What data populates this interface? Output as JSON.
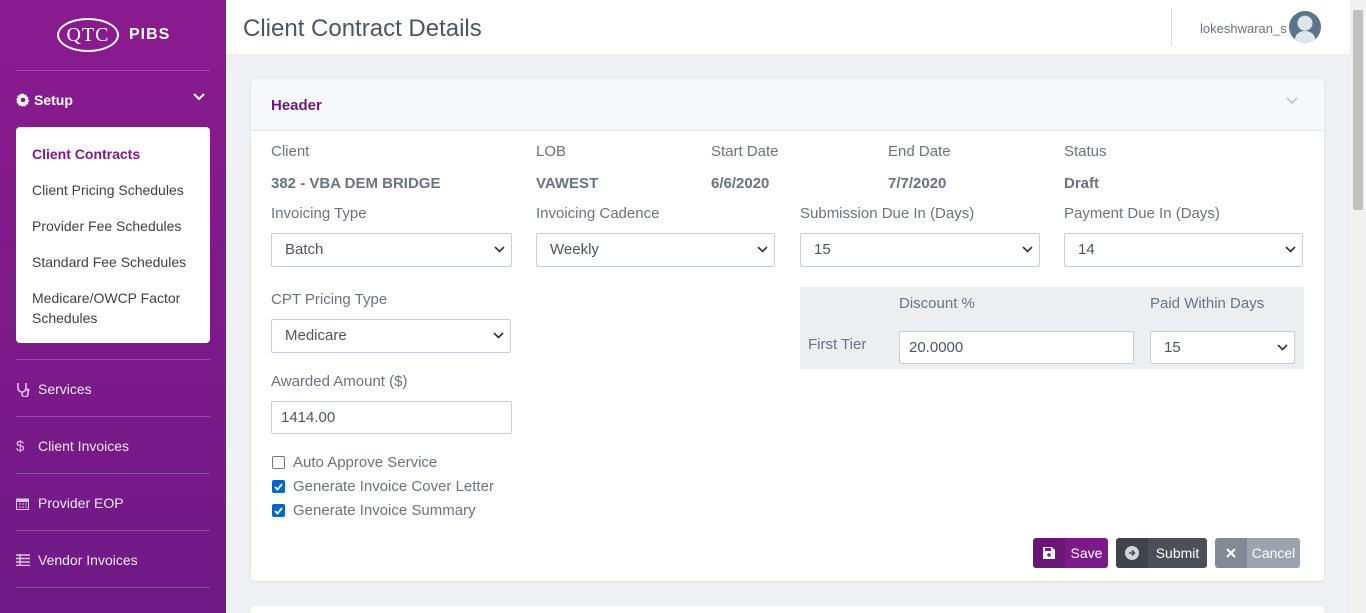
{
  "brand": {
    "logo": "QTC",
    "app": "PIBS"
  },
  "sidebar": {
    "setup_label": "Setup",
    "submenu": [
      {
        "label": "Client Contracts",
        "active": true
      },
      {
        "label": "Client Pricing Schedules"
      },
      {
        "label": "Provider Fee Schedules"
      },
      {
        "label": "Standard Fee Schedules"
      },
      {
        "label": "Medicare/OWCP Factor Schedules"
      }
    ],
    "nav": [
      {
        "label": "Services",
        "icon": "stethoscope-icon"
      },
      {
        "label": "Client Invoices",
        "icon": "dollar-icon"
      },
      {
        "label": "Provider EOP",
        "icon": "calendar-icon"
      },
      {
        "label": "Vendor Invoices",
        "icon": "table-icon"
      }
    ]
  },
  "header": {
    "title": "Client Contract Details",
    "username": "lokeshwaran_s"
  },
  "card": {
    "title": "Header",
    "client": {
      "label": "Client",
      "value": "382 - VBA DEM BRIDGE"
    },
    "lob": {
      "label": "LOB",
      "value": "VAWEST"
    },
    "start_date": {
      "label": "Start Date",
      "value": "6/6/2020"
    },
    "end_date": {
      "label": "End Date",
      "value": "7/7/2020"
    },
    "status": {
      "label": "Status",
      "value": "Draft"
    },
    "invoicing_type": {
      "label": "Invoicing Type",
      "value": "Batch"
    },
    "invoicing_cadence": {
      "label": "Invoicing Cadence",
      "value": "Weekly"
    },
    "submission_due": {
      "label": "Submission Due In (Days)",
      "value": "15"
    },
    "payment_due": {
      "label": "Payment Due In (Days)",
      "value": "14"
    },
    "cpt_pricing_type": {
      "label": "CPT Pricing Type",
      "value": "Medicare"
    },
    "awarded_amount": {
      "label": "Awarded Amount ($)",
      "value": "1414.00"
    },
    "tiers": {
      "discount_header": "Discount %",
      "paid_within_header": "Paid Within Days",
      "rows": [
        {
          "label": "First Tier",
          "discount": "20.0000",
          "paid_within": "15"
        }
      ]
    },
    "checkboxes": [
      {
        "label": "Auto Approve Service",
        "checked": false
      },
      {
        "label": "Generate Invoice Cover Letter",
        "checked": true
      },
      {
        "label": "Generate Invoice Summary",
        "checked": true
      }
    ],
    "buttons": {
      "save": "Save",
      "submit": "Submit",
      "cancel": "Cancel"
    }
  },
  "colors": {
    "brand": "#7d1a8a",
    "checkbox": "#0b63c9",
    "submit": "#4b4f57",
    "cancel": "#9ca3af"
  }
}
